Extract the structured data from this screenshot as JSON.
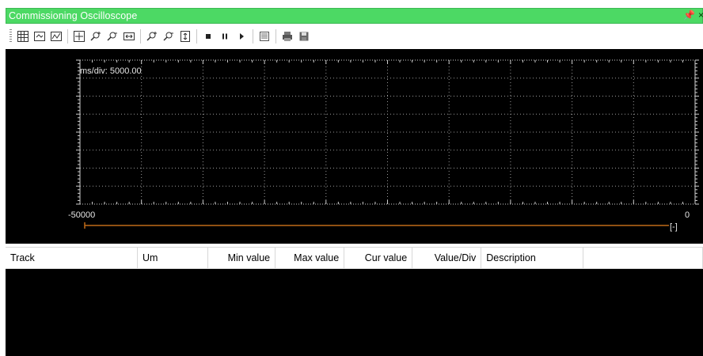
{
  "window": {
    "title": "Commissioning Oscilloscope",
    "pin_glyph": "⨁",
    "close_glyph": "×"
  },
  "toolbar": {
    "groups": [
      [
        "grid-icon",
        "zoom-fit-icon",
        "zoom-box-icon"
      ],
      [
        "cursor-cross-icon",
        "zoom-in-x-icon",
        "zoom-out-x-icon",
        "fit-width-icon"
      ],
      [
        "zoom-in-y-icon",
        "zoom-out-y-icon",
        "fit-height-icon"
      ],
      [
        "stop-icon",
        "pause-icon",
        "play-icon"
      ],
      [
        "settings-list-icon"
      ],
      [
        "print-icon",
        "save-icon"
      ]
    ]
  },
  "scope": {
    "time_div_label": "ms/div: 5000.00",
    "x_min_label": "-50000",
    "x_max_label": "0",
    "cursor_label": "[-]",
    "colors": {
      "background": "#000000",
      "grid": "#9a9a9a",
      "axis": "#cfcfcf",
      "timeline": "#c06a18"
    }
  },
  "table": {
    "columns": [
      {
        "label": "Track",
        "align": "left"
      },
      {
        "label": "Um",
        "align": "left"
      },
      {
        "label": "Min value",
        "align": "right"
      },
      {
        "label": "Max value",
        "align": "right"
      },
      {
        "label": "Cur value",
        "align": "right"
      },
      {
        "label": "Value/Div",
        "align": "right"
      },
      {
        "label": "Description",
        "align": "left"
      },
      {
        "label": "",
        "align": "left"
      }
    ],
    "rows": []
  }
}
